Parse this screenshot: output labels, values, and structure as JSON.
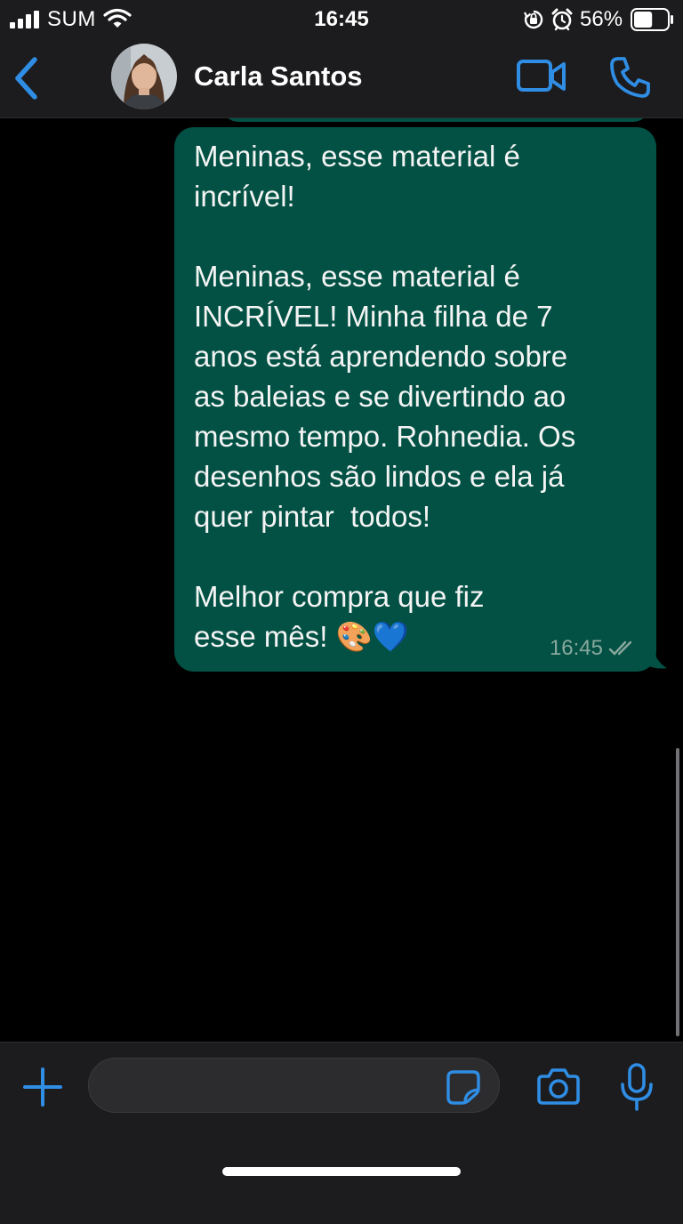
{
  "status_bar": {
    "carrier": "SUM",
    "time": "16:45",
    "battery_percent": "56%",
    "battery_level": 0.56,
    "icons": [
      "signal-icon",
      "wifi-icon",
      "orientation-lock-icon",
      "alarm-icon",
      "battery-icon"
    ]
  },
  "header": {
    "contact_name": "Carla Santos",
    "icons": [
      "back-chevron-icon",
      "video-camera-icon",
      "phone-icon"
    ]
  },
  "messages": [
    {
      "direction": "outgoing",
      "text": "Meninas, esse material é\nincrível!\n\nMeninas, esse material é\nINCRÍVEL! Minha filha de 7\nanos está aprendendo sobre\nas baleias e se divertindo ao\nmesmo tempo. Rohnedia. Os\ndesenhos são lindos e ela já\nquer pintar  todos!\n\nMelhor compra que fiz\nesse mês! 🎨💙",
      "time": "16:45",
      "status": "read-double-check"
    }
  ],
  "input_bar": {
    "placeholder": "",
    "value": "",
    "icons": [
      "plus-icon",
      "sticker-icon",
      "camera-icon",
      "microphone-icon"
    ]
  },
  "colors": {
    "accent": "#2f8de4",
    "bubble_outgoing": "#025144",
    "background": "#000000",
    "bar_background": "#1c1c1e"
  }
}
